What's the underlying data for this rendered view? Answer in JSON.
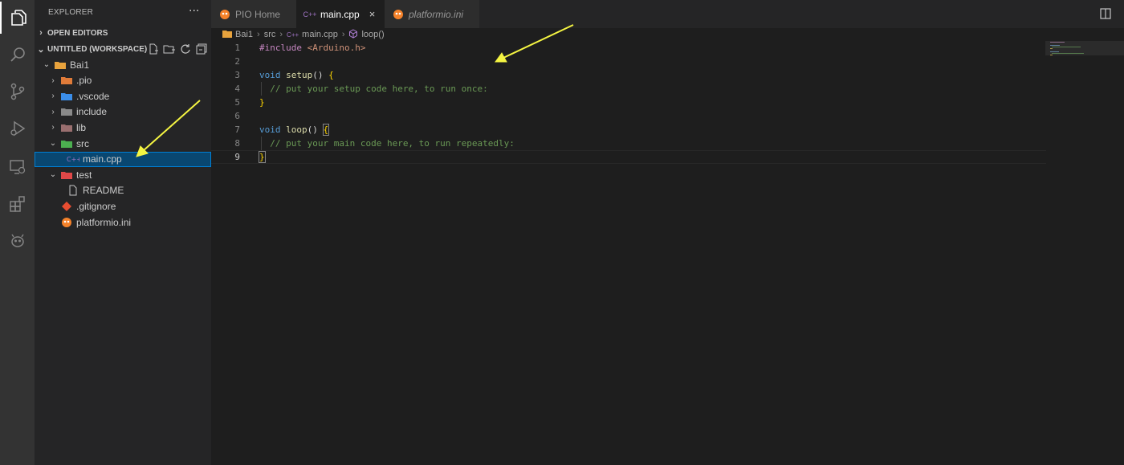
{
  "colors": {
    "activity_bar": "#333333",
    "sidebar": "#252526",
    "editor_bg": "#1e1e1e",
    "selection": "#094771",
    "annotation_arrow": "#f5f542"
  },
  "activity_bar": {
    "items": [
      {
        "name": "explorer",
        "icon": "files-icon",
        "active": true
      },
      {
        "name": "search",
        "icon": "search-icon"
      },
      {
        "name": "source-control",
        "icon": "source-control-icon"
      },
      {
        "name": "run-debug",
        "icon": "run-debug-icon"
      },
      {
        "name": "remote-explorer",
        "icon": "remote-explorer-icon"
      },
      {
        "name": "extensions",
        "icon": "extensions-icon"
      },
      {
        "name": "platformio",
        "icon": "platformio-alien-icon"
      }
    ]
  },
  "sidebar": {
    "title": "EXPLORER",
    "more_label": "···",
    "open_editors": "OPEN EDITORS",
    "workspace": "UNTITLED (WORKSPACE)",
    "tree": [
      {
        "label": "Bai1",
        "depth": 1,
        "chevron": "⌄",
        "icon": "folder-platformio-icon"
      },
      {
        "label": ".pio",
        "depth": 2,
        "chevron": "›",
        "icon": "folder-pio-icon"
      },
      {
        "label": ".vscode",
        "depth": 2,
        "chevron": "›",
        "icon": "folder-vscode-icon"
      },
      {
        "label": "include",
        "depth": 2,
        "chevron": "›",
        "icon": "folder-include-icon"
      },
      {
        "label": "lib",
        "depth": 2,
        "chevron": "›",
        "icon": "folder-lib-icon"
      },
      {
        "label": "src",
        "depth": 2,
        "chevron": "⌄",
        "icon": "folder-src-icon"
      },
      {
        "label": "main.cpp",
        "depth": 3,
        "chevron": "",
        "icon": "cpp-file-icon",
        "selected": true
      },
      {
        "label": "test",
        "depth": 2,
        "chevron": "⌄",
        "icon": "folder-test-icon"
      },
      {
        "label": "README",
        "depth": 3,
        "chevron": "",
        "icon": "file-icon"
      },
      {
        "label": ".gitignore",
        "depth": 2,
        "chevron": "",
        "icon": "git-icon"
      },
      {
        "label": "platformio.ini",
        "depth": 2,
        "chevron": "",
        "icon": "platformio-file-icon"
      }
    ]
  },
  "tabs": [
    {
      "label": "PIO Home",
      "icon": "platformio-icon",
      "icon_text": ""
    },
    {
      "label": "main.cpp",
      "icon": "cpp-icon",
      "icon_text": "C++",
      "active": true,
      "close": "×"
    },
    {
      "label": "platformio.ini",
      "icon": "platformio-icon",
      "icon_text": "",
      "italic": true
    }
  ],
  "breadcrumb": {
    "items": [
      "Bai1",
      "src",
      "main.cpp",
      "loop()"
    ],
    "separator": "›"
  },
  "editor": {
    "current_line": 9,
    "lines": [
      {
        "n": "1"
      },
      {
        "n": "2"
      },
      {
        "n": "3"
      },
      {
        "n": "4"
      },
      {
        "n": "5"
      },
      {
        "n": "6"
      },
      {
        "n": "7"
      },
      {
        "n": "8"
      },
      {
        "n": "9"
      }
    ],
    "tokens": {
      "include_kw": "#include",
      "include_arg": "<Arduino.h>",
      "void1": "void",
      "setup_fn": "setup",
      "parens1": "()",
      "brace_open1": "{",
      "setup_comment": "// put your setup code here, to run once:",
      "brace_close1": "}",
      "void2": "void",
      "loop_fn": "loop",
      "parens2": "()",
      "brace_open2": "{",
      "loop_comment": "// put your main code here, to run repeatedly:",
      "brace_close2": "}"
    }
  }
}
